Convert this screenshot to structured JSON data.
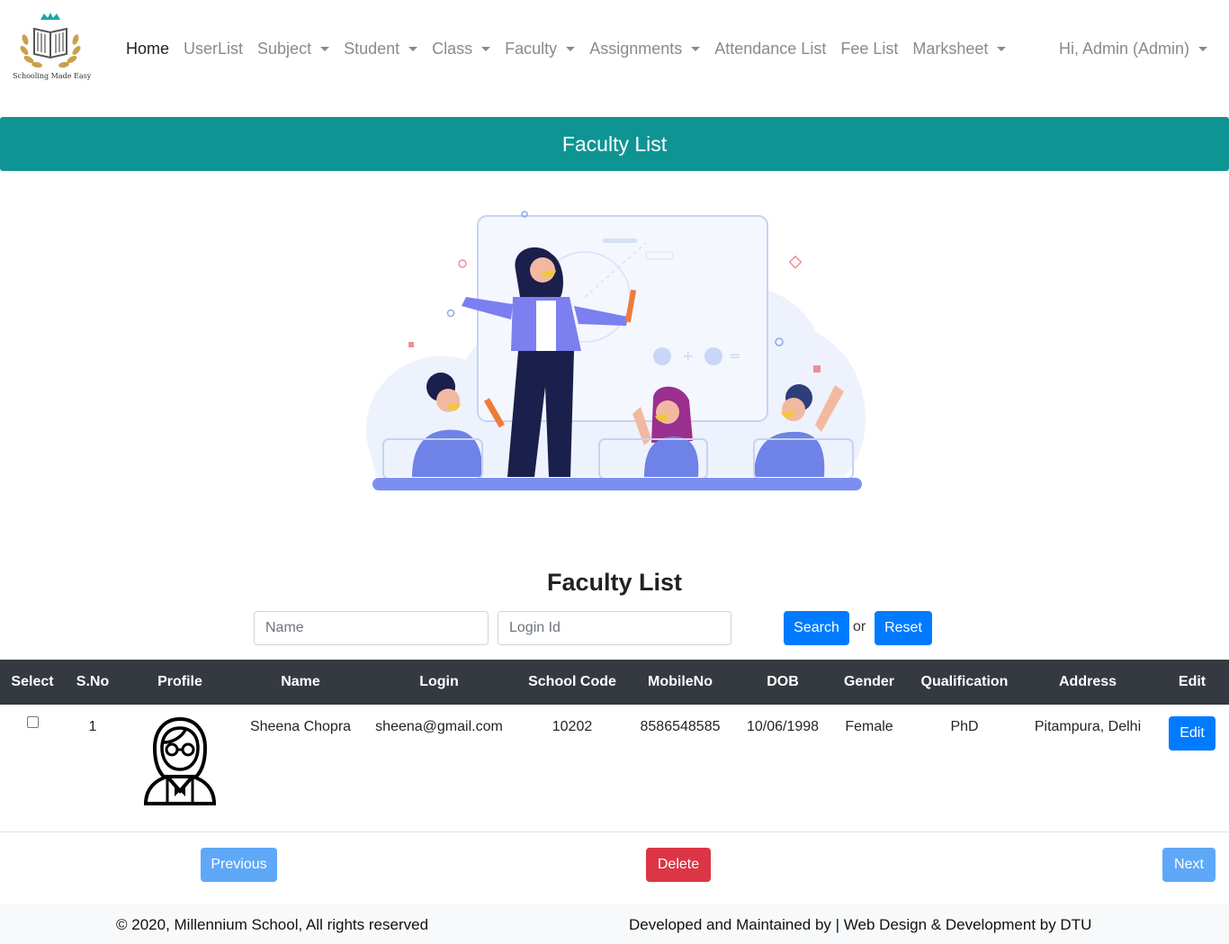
{
  "brand": {
    "tagline": "Schooling Made Easy"
  },
  "nav": {
    "home": "Home",
    "userlist": "UserList",
    "subject": "Subject",
    "student": "Student",
    "class": "Class",
    "faculty": "Faculty",
    "assignments": "Assignments",
    "attendance": "Attendance List",
    "fee": "Fee List",
    "marksheet": "Marksheet",
    "user": "Hi, Admin (Admin)"
  },
  "banner": {
    "title": "Faculty List"
  },
  "search": {
    "title": "Faculty List",
    "name_placeholder": "Name",
    "login_placeholder": "Login Id",
    "search_label": "Search",
    "or_label": "or",
    "reset_label": "Reset"
  },
  "table": {
    "headers": {
      "select": "Select",
      "sno": "S.No",
      "profile": "Profile",
      "name": "Name",
      "login": "Login",
      "school_code": "School Code",
      "mobile": "MobileNo",
      "dob": "DOB",
      "gender": "Gender",
      "qualification": "Qualification",
      "address": "Address",
      "edit": "Edit"
    },
    "rows": [
      {
        "sno": "1",
        "name": "Sheena Chopra",
        "login": "sheena@gmail.com",
        "school_code": "10202",
        "mobile": "8586548585",
        "dob": "10/06/1998",
        "gender": "Female",
        "qualification": "PhD",
        "address": "Pitampura, Delhi",
        "edit_label": "Edit",
        "selected": false
      }
    ]
  },
  "pagination": {
    "previous": "Previous",
    "delete": "Delete",
    "next": "Next"
  },
  "footer": {
    "left": "© 2020, Millennium School, All rights reserved",
    "right": "Developed and Maintained by | Web Design & Development by DTU"
  },
  "colors": {
    "banner": "#0f9494",
    "primary": "#007bff",
    "danger": "#dc3545",
    "table_header": "#343a40"
  }
}
